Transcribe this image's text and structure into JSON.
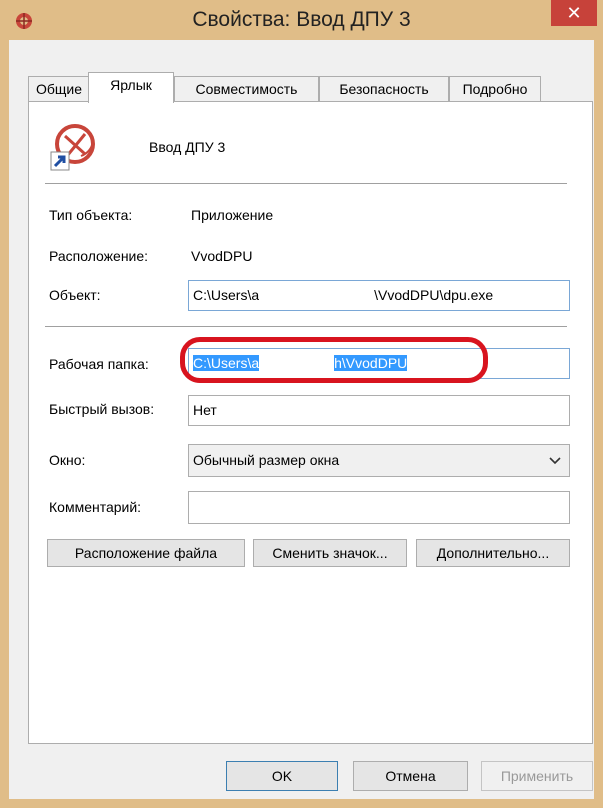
{
  "window": {
    "title": "Свойства: Ввод ДПУ 3",
    "close_glyph": "✕"
  },
  "tabs": [
    {
      "label": "Общие"
    },
    {
      "label": "Ярлык"
    },
    {
      "label": "Совместимость"
    },
    {
      "label": "Безопасность"
    },
    {
      "label": "Подробно"
    }
  ],
  "shortcut": {
    "name": "Ввод ДПУ 3",
    "icon": "shortcut-app-icon",
    "type_label": "Тип объекта:",
    "type_value": "Приложение",
    "location_label": "Расположение:",
    "location_value": "VvodDPU",
    "target_label": "Объект:",
    "target_value_a": "C:\\Users\\a",
    "target_value_b": "\\VvodDPU\\dpu.exe",
    "start_in_label": "Рабочая папка:",
    "start_in_value_a": "C:\\Users\\a",
    "start_in_value_b": "h\\VvodDPU",
    "hotkey_label": "Быстрый вызов:",
    "hotkey_value": "Нет",
    "run_label": "Окно:",
    "run_value": "Обычный размер окна",
    "comment_label": "Комментарий:",
    "comment_value": "",
    "open_location_button": "Расположение файла",
    "change_icon_button": "Сменить значок...",
    "advanced_button": "Дополнительно..."
  },
  "footer": {
    "ok": "OK",
    "cancel": "Отмена",
    "apply": "Применить"
  },
  "colors": {
    "titlebar": "#e0bd88",
    "close": "#c7423a",
    "highlight": "#3399ff",
    "annotation": "#d8141f"
  }
}
